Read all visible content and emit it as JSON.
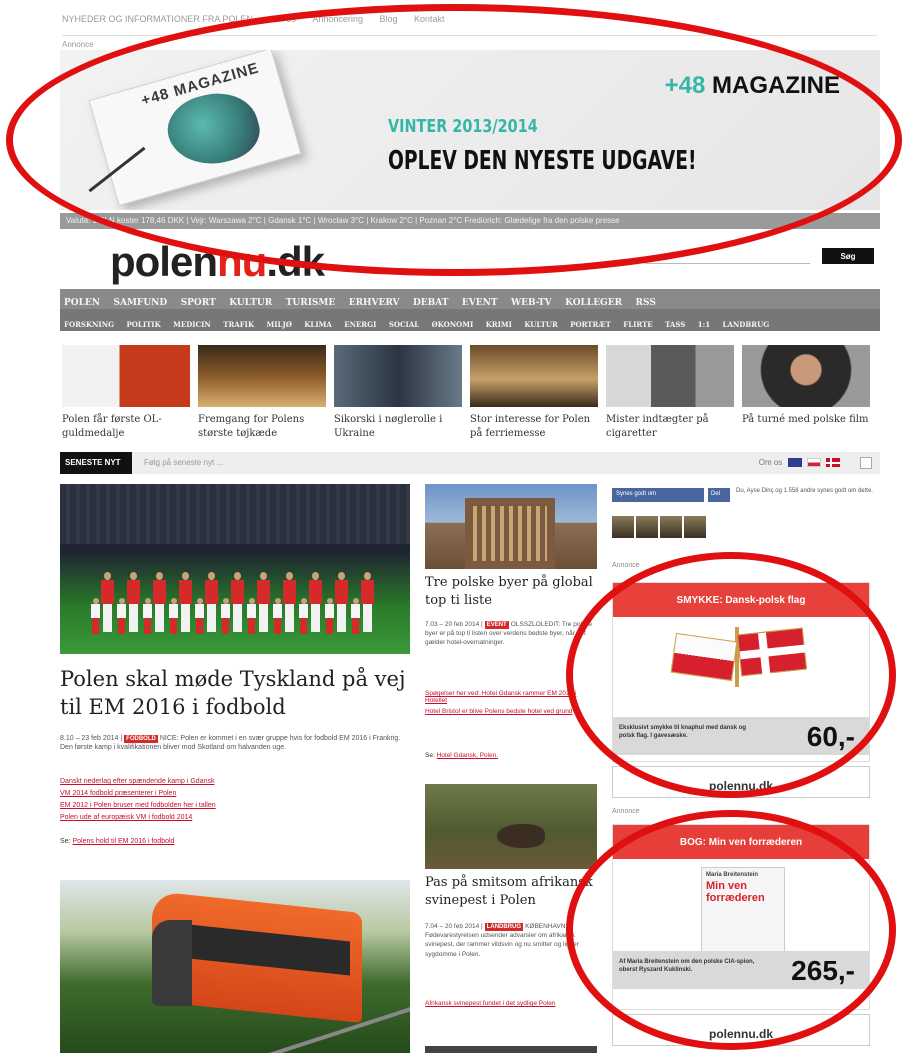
{
  "topbar": {
    "items": [
      "NYHEDER OG INFORMATIONER FRA POLEN",
      "Om os",
      "Annoncering",
      "Blog",
      "Kontakt"
    ]
  },
  "banner": {
    "annonce_label": "Annonce",
    "magazine_cover_title": "+48 MAGAZINE",
    "logo_prefix": "+48",
    "logo_suffix": " MAGAZINE",
    "season": "VINTER 2013/2014",
    "cta": "OPLEV DEN NYESTE UDGAVE!"
  },
  "ticker": {
    "text": "Valuta: 1 PLN koster 178,46 DKK | Vejr: Warszawa 2°C | Gdansk 1°C | Wroclaw 3°C | Krakow 2°C | Poznan 2°C   Frediorich: Glædelige fra den polske presse"
  },
  "header": {
    "logo_main": "polen",
    "logo_nu": "nu",
    "logo_tld": ".dk",
    "search_button": "Søg"
  },
  "nav": {
    "primary": [
      "POLEN",
      "SAMFUND",
      "SPORT",
      "KULTUR",
      "TURISME",
      "ERHVERV",
      "DEBAT",
      "EVENT",
      "WEB-TV",
      "KOLLEGER",
      "RSS"
    ],
    "secondary": [
      "FORSKNING",
      "POLITIK",
      "MEDICIN",
      "TRAFIK",
      "MILJØ",
      "KLIMA",
      "ENERGI",
      "SOCIAL",
      "ØKONOMI",
      "KRIMI",
      "KULTUR",
      "PORTRÆT",
      "FLIRTE",
      "TASS",
      "1:1",
      "LANDBRUG"
    ]
  },
  "thumbs": [
    {
      "caption": "Polen får første OL-guldmedalje"
    },
    {
      "caption": "Fremgang for Polens største tøjkæde"
    },
    {
      "caption": "Sikorski i nøglerolle i Ukraine"
    },
    {
      "caption": "Stor interesse for Polen på ferriemesse"
    },
    {
      "caption": "Mister indtægter på cigaretter"
    },
    {
      "caption": "På turné med polske film"
    }
  ],
  "sense_bar": {
    "label": "SENESTE NYT",
    "text": "Følg på seneste nyt ...",
    "lang_label": "Om os"
  },
  "lead": {
    "title": "Polen skal møde Tyskland på vej til EM 2016 i fodbold",
    "meta_date": "8.10 – 23 feb 2014 |",
    "tag": "FODBOLD",
    "meta_text": "NICE: Polen er kommet i en svær gruppe hvis for fodbold EM 2016 i Frankrig. Den første kamp i kvalifikationen bliver mod Skotland om halvanden uge.",
    "links": [
      "Danskt nederlag efter spændende kamp i Gdansk",
      "VM 2014 fodbold præsenterer i Polen",
      "EM 2012 i Polen bruser med fodbolden her i tallen",
      "Polen ude af europæisk VM i fodbold 2014"
    ],
    "see_also_prefix": "Se:",
    "see_also_link": "Polens hold til EM 2016 i fodbold"
  },
  "mid": {
    "story1": {
      "title": "Tre polske byer på global top ti liste",
      "meta_date": "7.03 – 20 feb 2014 |",
      "tag": "EVENT",
      "meta_text": "OLSSZLOLEDIT: Tre polske byer er på top ti listen over verdens bedste byer, når det gælder hotel-overnatninger.",
      "links": [
        "Spøgelser her ved: Hotel Gdansk rammer EM 2012 i Hotellet",
        "Hotel Bristol er blive Polens bedste hotel ved grund"
      ],
      "see_also_prefix": "Se:",
      "see_also_link": "Hotel Gdansk, Polen."
    },
    "story2": {
      "title": "Pas på smitsom afrikansk svinepest i Polen",
      "meta_date": "7.04 – 20 feb 2014 |",
      "tag": "LANDBRUG",
      "meta_text": "KØBENHAVN: Fødevarestyrelsen udsender advarsler om afrikansk svinepest, der rammer vildsvin og nu smitter og ligner sygdomme i Polen.",
      "links": [
        "Afrikansk svinepest fundet i det sydlige Polen"
      ]
    }
  },
  "sidebar": {
    "fb_like": "Synes godt om",
    "fb_share": "Del",
    "social_text": "Du, Ayse Dinç og 1.558 andre synes godt om dette.",
    "annonce_label": "Annonce",
    "ad1": {
      "header": "SMYKKE: Dansk-polsk flag",
      "description": "Eksklusivt smykke til knaphul med dansk og polsk flag. I gavesæske.",
      "price": "60,-",
      "footer": "polennu.dk"
    },
    "ad2": {
      "header": "BOG: Min ven forræderen",
      "book_author": "Maria Breitenstein",
      "book_title": "Min ven forræderen",
      "description": "Af Maria Breitenstein om den polske CIA-spion, oberst Ryszard Kuklinski.",
      "price": "265,-",
      "footer": "polennu.dk"
    }
  }
}
